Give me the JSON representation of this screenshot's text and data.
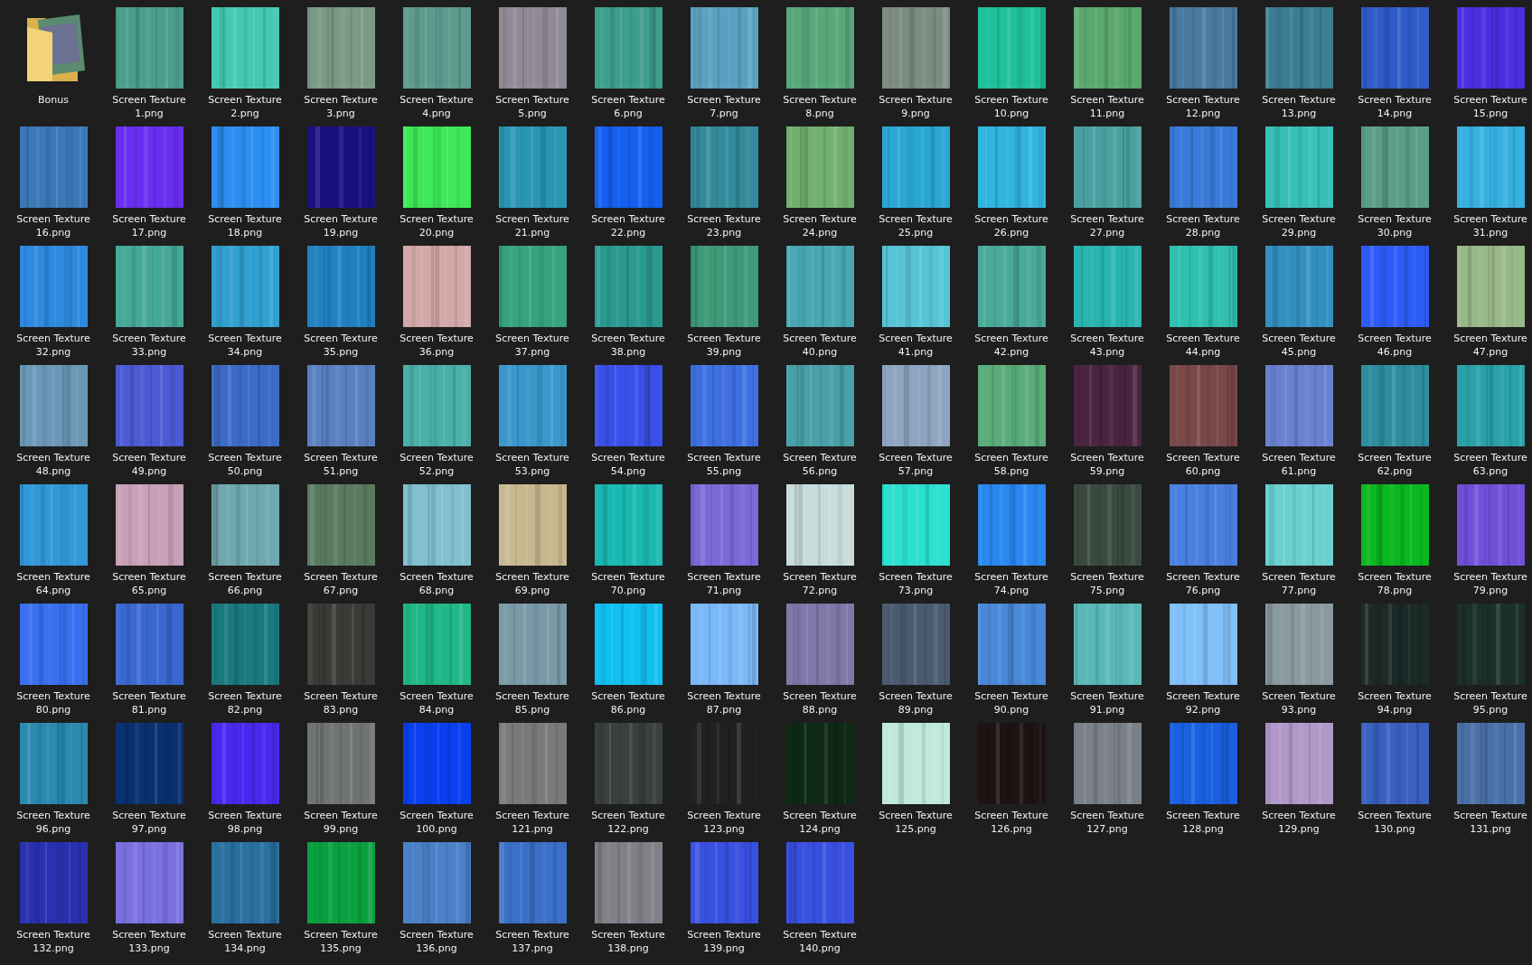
{
  "items": [
    {
      "kind": "folder",
      "name": "Bonus"
    },
    {
      "kind": "file",
      "name": "Screen Texture 1.png"
    },
    {
      "kind": "file",
      "name": "Screen Texture 2.png"
    },
    {
      "kind": "file",
      "name": "Screen Texture 3.png"
    },
    {
      "kind": "file",
      "name": "Screen Texture 4.png"
    },
    {
      "kind": "file",
      "name": "Screen Texture 5.png"
    },
    {
      "kind": "file",
      "name": "Screen Texture 6.png"
    },
    {
      "kind": "file",
      "name": "Screen Texture 7.png"
    },
    {
      "kind": "file",
      "name": "Screen Texture 8.png"
    },
    {
      "kind": "file",
      "name": "Screen Texture 9.png"
    },
    {
      "kind": "file",
      "name": "Screen Texture 10.png"
    },
    {
      "kind": "file",
      "name": "Screen Texture 11.png"
    },
    {
      "kind": "file",
      "name": "Screen Texture 12.png"
    },
    {
      "kind": "file",
      "name": "Screen Texture 13.png"
    },
    {
      "kind": "file",
      "name": "Screen Texture 14.png"
    },
    {
      "kind": "file",
      "name": "Screen Texture 15.png"
    },
    {
      "kind": "file",
      "name": "Screen Texture 16.png"
    },
    {
      "kind": "file",
      "name": "Screen Texture 17.png"
    },
    {
      "kind": "file",
      "name": "Screen Texture 18.png"
    },
    {
      "kind": "file",
      "name": "Screen Texture 19.png"
    },
    {
      "kind": "file",
      "name": "Screen Texture 20.png"
    },
    {
      "kind": "file",
      "name": "Screen Texture 21.png"
    },
    {
      "kind": "file",
      "name": "Screen Texture 22.png"
    },
    {
      "kind": "file",
      "name": "Screen Texture 23.png"
    },
    {
      "kind": "file",
      "name": "Screen Texture 24.png"
    },
    {
      "kind": "file",
      "name": "Screen Texture 25.png"
    },
    {
      "kind": "file",
      "name": "Screen Texture 26.png"
    },
    {
      "kind": "file",
      "name": "Screen Texture 27.png"
    },
    {
      "kind": "file",
      "name": "Screen Texture 28.png"
    },
    {
      "kind": "file",
      "name": "Screen Texture 29.png"
    },
    {
      "kind": "file",
      "name": "Screen Texture 30.png"
    },
    {
      "kind": "file",
      "name": "Screen Texture 31.png"
    },
    {
      "kind": "file",
      "name": "Screen Texture 32.png"
    },
    {
      "kind": "file",
      "name": "Screen Texture 33.png"
    },
    {
      "kind": "file",
      "name": "Screen Texture 34.png"
    },
    {
      "kind": "file",
      "name": "Screen Texture 35.png"
    },
    {
      "kind": "file",
      "name": "Screen Texture 36.png"
    },
    {
      "kind": "file",
      "name": "Screen Texture 37.png"
    },
    {
      "kind": "file",
      "name": "Screen Texture 38.png"
    },
    {
      "kind": "file",
      "name": "Screen Texture 39.png"
    },
    {
      "kind": "file",
      "name": "Screen Texture 40.png"
    },
    {
      "kind": "file",
      "name": "Screen Texture 41.png"
    },
    {
      "kind": "file",
      "name": "Screen Texture 42.png"
    },
    {
      "kind": "file",
      "name": "Screen Texture 43.png"
    },
    {
      "kind": "file",
      "name": "Screen Texture 44.png"
    },
    {
      "kind": "file",
      "name": "Screen Texture 45.png"
    },
    {
      "kind": "file",
      "name": "Screen Texture 46.png"
    },
    {
      "kind": "file",
      "name": "Screen Texture 47.png"
    },
    {
      "kind": "file",
      "name": "Screen Texture 48.png"
    },
    {
      "kind": "file",
      "name": "Screen Texture 49.png"
    },
    {
      "kind": "file",
      "name": "Screen Texture 50.png"
    },
    {
      "kind": "file",
      "name": "Screen Texture 51.png"
    },
    {
      "kind": "file",
      "name": "Screen Texture 52.png"
    },
    {
      "kind": "file",
      "name": "Screen Texture 53.png"
    },
    {
      "kind": "file",
      "name": "Screen Texture 54.png"
    },
    {
      "kind": "file",
      "name": "Screen Texture 55.png"
    },
    {
      "kind": "file",
      "name": "Screen Texture 56.png"
    },
    {
      "kind": "file",
      "name": "Screen Texture 57.png"
    },
    {
      "kind": "file",
      "name": "Screen Texture 58.png"
    },
    {
      "kind": "file",
      "name": "Screen Texture 59.png"
    },
    {
      "kind": "file",
      "name": "Screen Texture 60.png"
    },
    {
      "kind": "file",
      "name": "Screen Texture 61.png"
    },
    {
      "kind": "file",
      "name": "Screen Texture 62.png"
    },
    {
      "kind": "file",
      "name": "Screen Texture 63.png"
    },
    {
      "kind": "file",
      "name": "Screen Texture 64.png"
    },
    {
      "kind": "file",
      "name": "Screen Texture 65.png"
    },
    {
      "kind": "file",
      "name": "Screen Texture 66.png"
    },
    {
      "kind": "file",
      "name": "Screen Texture 67.png"
    },
    {
      "kind": "file",
      "name": "Screen Texture 68.png"
    },
    {
      "kind": "file",
      "name": "Screen Texture 69.png"
    },
    {
      "kind": "file",
      "name": "Screen Texture 70.png"
    },
    {
      "kind": "file",
      "name": "Screen Texture 71.png"
    },
    {
      "kind": "file",
      "name": "Screen Texture 72.png"
    },
    {
      "kind": "file",
      "name": "Screen Texture 73.png"
    },
    {
      "kind": "file",
      "name": "Screen Texture 74.png"
    },
    {
      "kind": "file",
      "name": "Screen Texture 75.png"
    },
    {
      "kind": "file",
      "name": "Screen Texture 76.png"
    },
    {
      "kind": "file",
      "name": "Screen Texture 77.png"
    },
    {
      "kind": "file",
      "name": "Screen Texture 78.png"
    },
    {
      "kind": "file",
      "name": "Screen Texture 79.png"
    },
    {
      "kind": "file",
      "name": "Screen Texture 80.png"
    },
    {
      "kind": "file",
      "name": "Screen Texture 81.png"
    },
    {
      "kind": "file",
      "name": "Screen Texture 82.png"
    },
    {
      "kind": "file",
      "name": "Screen Texture 83.png"
    },
    {
      "kind": "file",
      "name": "Screen Texture 84.png"
    },
    {
      "kind": "file",
      "name": "Screen Texture 85.png"
    },
    {
      "kind": "file",
      "name": "Screen Texture 86.png"
    },
    {
      "kind": "file",
      "name": "Screen Texture 87.png"
    },
    {
      "kind": "file",
      "name": "Screen Texture 88.png"
    },
    {
      "kind": "file",
      "name": "Screen Texture 89.png"
    },
    {
      "kind": "file",
      "name": "Screen Texture 90.png"
    },
    {
      "kind": "file",
      "name": "Screen Texture 91.png"
    },
    {
      "kind": "file",
      "name": "Screen Texture 92.png"
    },
    {
      "kind": "file",
      "name": "Screen Texture 93.png"
    },
    {
      "kind": "file",
      "name": "Screen Texture 94.png"
    },
    {
      "kind": "file",
      "name": "Screen Texture 95.png"
    },
    {
      "kind": "file",
      "name": "Screen Texture 96.png"
    },
    {
      "kind": "file",
      "name": "Screen Texture 97.png"
    },
    {
      "kind": "file",
      "name": "Screen Texture 98.png"
    },
    {
      "kind": "file",
      "name": "Screen Texture 99.png"
    },
    {
      "kind": "file",
      "name": "Screen Texture 100.png"
    },
    {
      "kind": "file",
      "name": "Screen Texture 121.png"
    },
    {
      "kind": "file",
      "name": "Screen Texture 122.png"
    },
    {
      "kind": "file",
      "name": "Screen Texture 123.png"
    },
    {
      "kind": "file",
      "name": "Screen Texture 124.png"
    },
    {
      "kind": "file",
      "name": "Screen Texture 125.png"
    },
    {
      "kind": "file",
      "name": "Screen Texture 126.png"
    },
    {
      "kind": "file",
      "name": "Screen Texture 127.png"
    },
    {
      "kind": "file",
      "name": "Screen Texture 128.png"
    },
    {
      "kind": "file",
      "name": "Screen Texture 129.png"
    },
    {
      "kind": "file",
      "name": "Screen Texture 130.png"
    },
    {
      "kind": "file",
      "name": "Screen Texture 131.png"
    },
    {
      "kind": "file",
      "name": "Screen Texture 132.png"
    },
    {
      "kind": "file",
      "name": "Screen Texture 133.png"
    },
    {
      "kind": "file",
      "name": "Screen Texture 134.png"
    },
    {
      "kind": "file",
      "name": "Screen Texture 135.png"
    },
    {
      "kind": "file",
      "name": "Screen Texture 136.png"
    },
    {
      "kind": "file",
      "name": "Screen Texture 137.png"
    },
    {
      "kind": "file",
      "name": "Screen Texture 138.png"
    },
    {
      "kind": "file",
      "name": "Screen Texture 139.png"
    },
    {
      "kind": "file",
      "name": "Screen Texture 140.png"
    }
  ]
}
